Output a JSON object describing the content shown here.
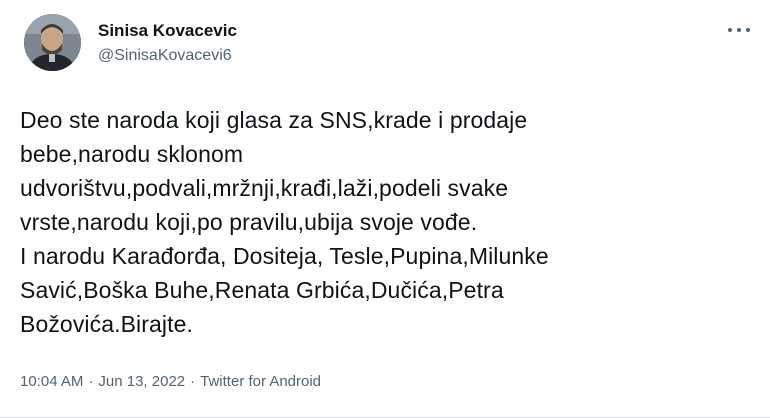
{
  "author": {
    "display_name": "Sinisa Kovacevic",
    "handle": "@SinisaKovacevi6"
  },
  "tweet": {
    "lines": [
      "Deo ste naroda koji glasa za SNS,krade i prodaje",
      "bebe,narodu sklonom",
      "udvorištvu,podvali,mržnji,krađi,laži,podeli svake",
      "vrste,narodu koji,po pravilu,ubija svoje vođe.",
      "I narodu Karađorđa, Dositeja, Tesle,Pupina,Milunke",
      "Savić,Boška Buhe,Renata Grbića,Dučića,Petra",
      "Božovića.Birajte."
    ]
  },
  "meta": {
    "time": "10:04 AM",
    "separator": "·",
    "date": "Jun 13, 2022",
    "source": "Twitter for Android"
  },
  "icons": {
    "more": "more-horizontal-icon",
    "avatar": "profile-photo"
  },
  "colors": {
    "text_primary": "#0f1419",
    "text_secondary": "#536471",
    "divider": "#cfd9de"
  }
}
